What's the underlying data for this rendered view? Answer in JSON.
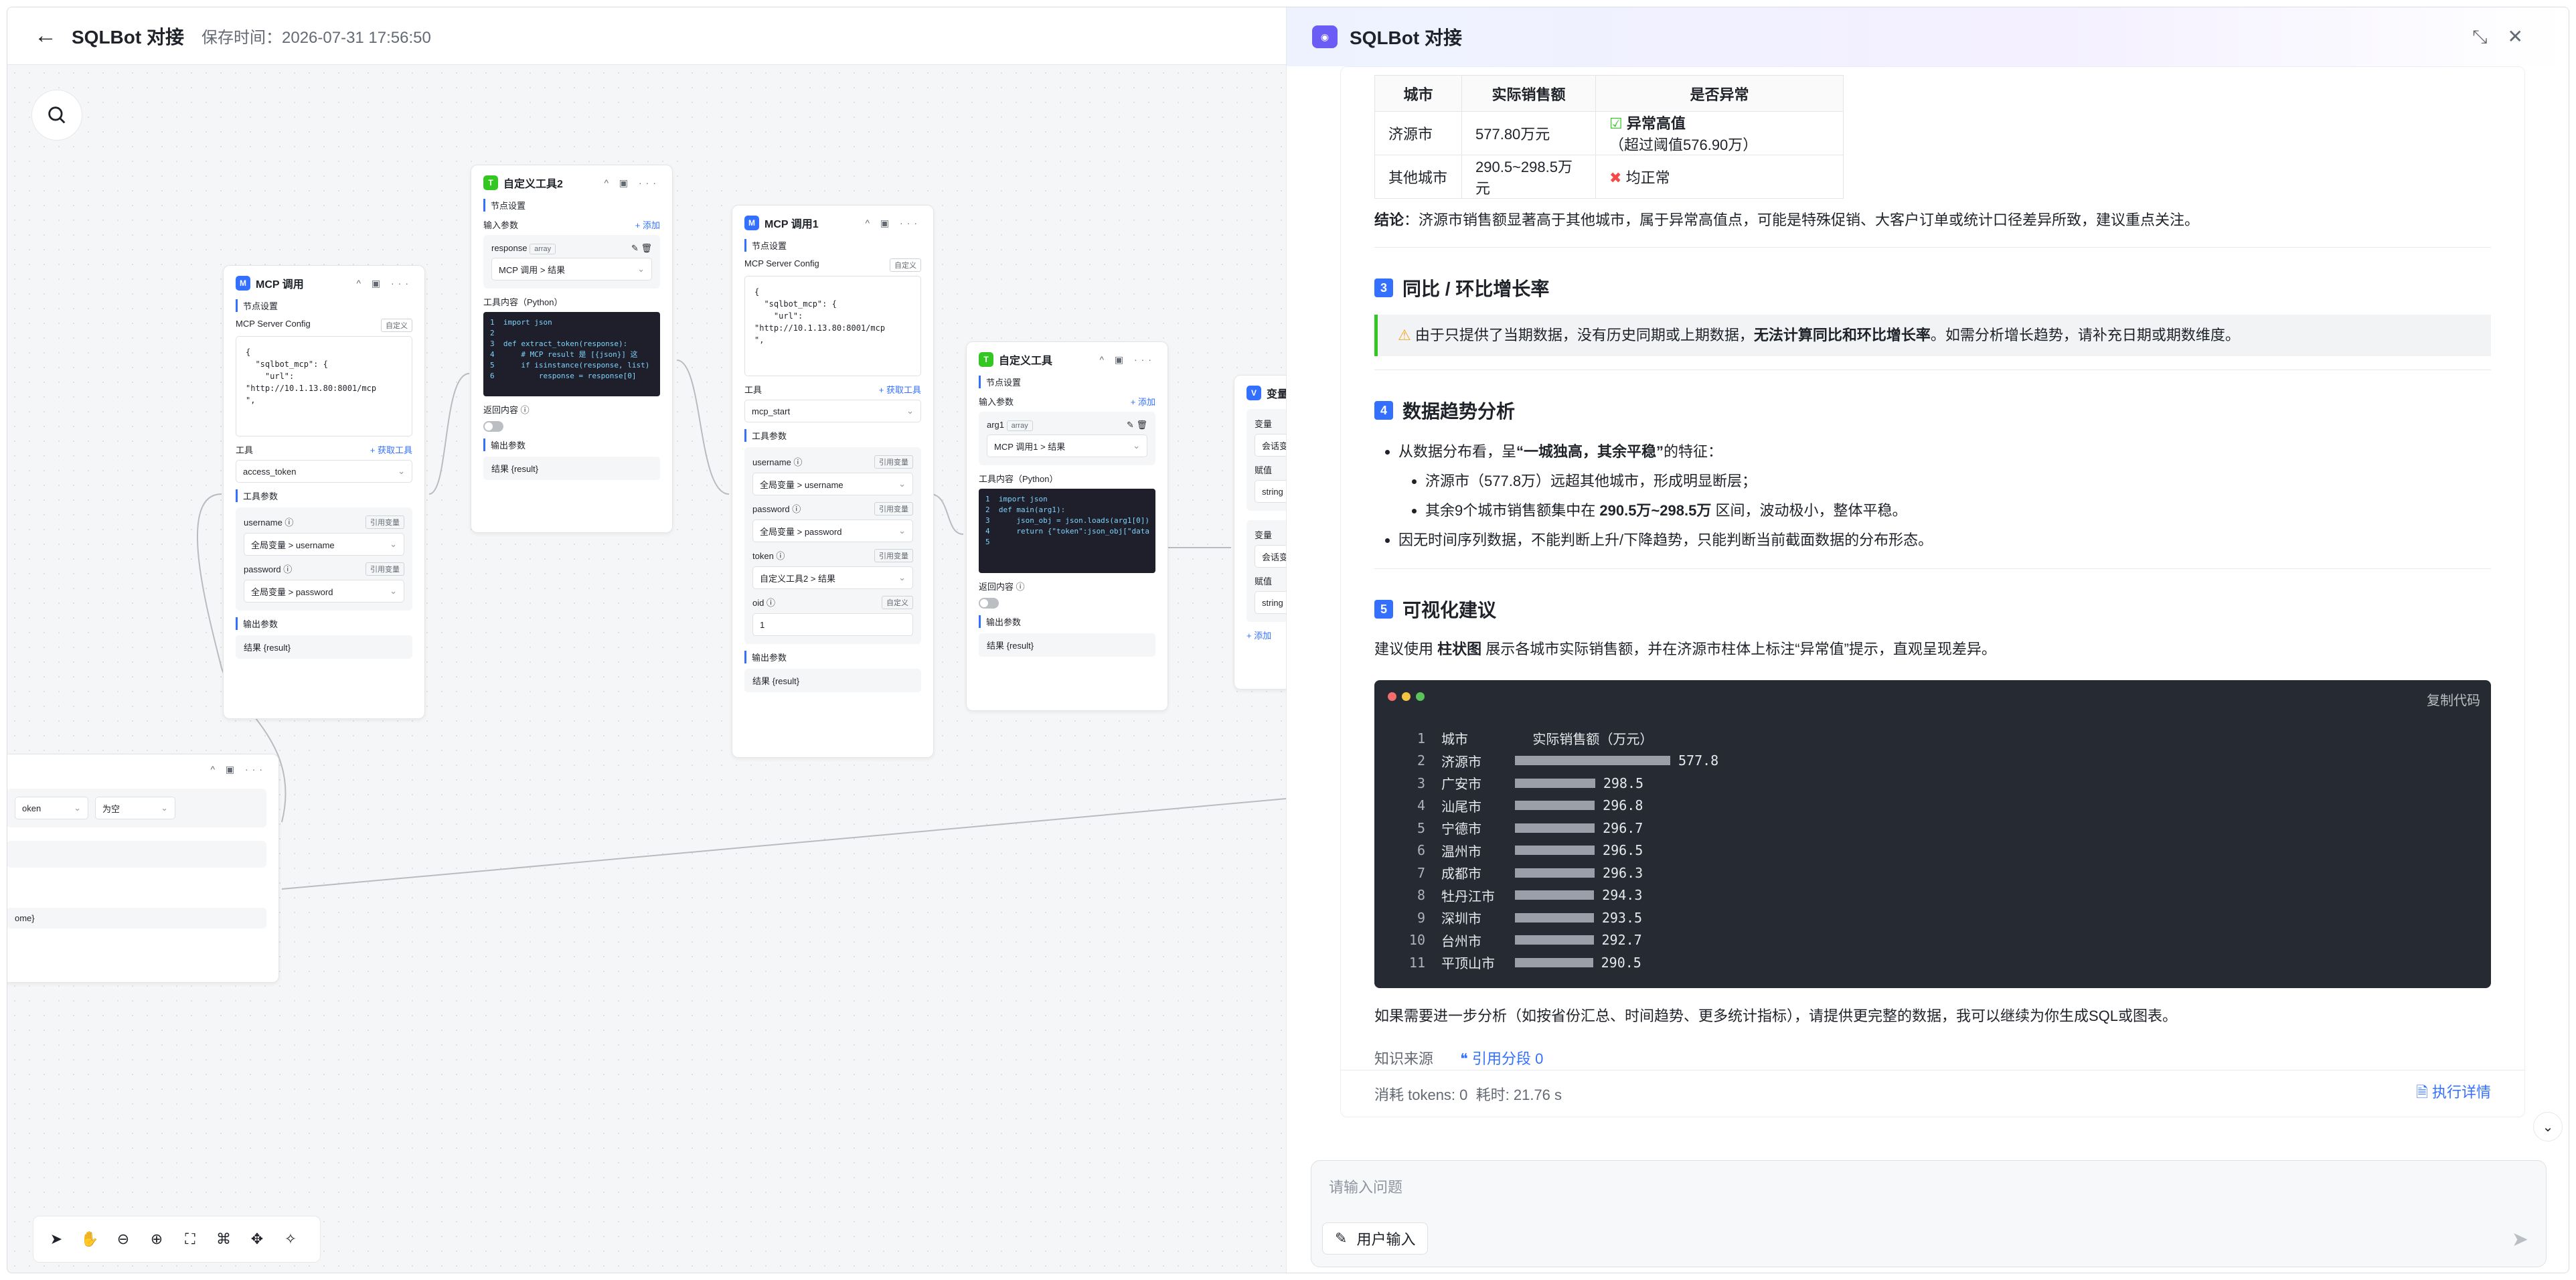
{
  "topbar": {
    "title": "SQLBot 对接",
    "saved": "保存时间：2026-07-31 17:56:50"
  },
  "canvas": {
    "nodes": [
      {
        "title": "MCP 调用",
        "settings": "节点设置",
        "config_label": "MCP Server Config",
        "config_mode": "自定义",
        "config_json": "{\n  \"sqlbot_mcp\": {\n    \"url\":\n\"http://10.1.13.80:8001/mcp\n\",",
        "tool_label": "工具",
        "tool_action": "+ 获取工具",
        "tool_value": "access_token",
        "params_label": "工具参数",
        "p1": "username ⓘ",
        "p1_ref": "引用变量",
        "p1_val": "全局变量 > username",
        "p2": "password ⓘ",
        "p2_ref": "引用变量",
        "p2_val": "全局变量 > password",
        "output_label": "输出参数",
        "output": "结果 {result}"
      },
      {
        "title": "自定义工具2",
        "settings": "节点设置",
        "input_label": "输入参数",
        "add": "+ 添加",
        "param": "response",
        "param_type": "array",
        "param_val": "MCP 调用 > 结果",
        "content_label": "工具内容（Python）",
        "code": "1  import json\n2\n3  def extract_token(response):\n4      # MCP result 是 [{json}] 这\n5      if isinstance(response, list)\n6          response = response[0]",
        "return_label": "返回内容 ⓘ",
        "output_label": "输出参数",
        "output": "结果 {result}"
      },
      {
        "title": "MCP 调用1",
        "settings": "节点设置",
        "config_label": "MCP Server Config",
        "config_mode": "自定义",
        "config_json": "{\n  \"sqlbot_mcp\": {\n    \"url\":\n\"http://10.1.13.80:8001/mcp\n\",",
        "tool_label": "工具",
        "tool_action": "+ 获取工具",
        "tool_value": "mcp_start",
        "params_label": "工具参数",
        "p1": "username ⓘ",
        "p1_ref": "引用变量",
        "p1_val": "全局变量 > username",
        "p2": "password ⓘ",
        "p2_ref": "引用变量",
        "p2_val": "全局变量 > password",
        "p3": "token ⓘ",
        "p3_ref": "引用变量",
        "p3_val": "自定义工具2 > 结果",
        "p4": "oid ⓘ",
        "p4_ref": "自定义",
        "p4_val": "1",
        "output_label": "输出参数",
        "output": "结果 {result}"
      },
      {
        "title": "自定义工具",
        "settings": "节点设置",
        "input_label": "输入参数",
        "add": "+ 添加",
        "param": "arg1",
        "param_type": "array",
        "param_val": "MCP 调用1 > 结果",
        "content_label": "工具内容（Python）",
        "code": "1  import json\n2  def main(arg1):\n3      json_obj = json.loads(arg1[0])\n4      return {\"token\":json_obj[\"data\n5",
        "return_label": "返回内容 ⓘ",
        "output_label": "输出参数",
        "output": "结果 {result}"
      },
      {
        "title": "变量赋",
        "v1": "变量",
        "v1_val": "会话变",
        "v2": "赋值",
        "v2_val": "string",
        "v3": "变量",
        "v3_val": "会话变",
        "v4": "赋值",
        "v4_val": "string",
        "add": "+ 添加"
      },
      {
        "field1": "oken",
        "field2": "为空",
        "output": "ome}"
      }
    ],
    "toolbar": [
      "navigate-icon",
      "hand-icon",
      "zoom-out-icon",
      "zoom-in-icon",
      "fit-icon",
      "layout-icon",
      "move-icon",
      "magic-icon"
    ]
  },
  "panel": {
    "title": "SQLBot 对接",
    "table": {
      "headers": [
        "城市",
        "实际销售额",
        "是否异常"
      ],
      "rows": [
        [
          "济源市",
          "577.80万元",
          "异常高值",
          "（超过阈值576.90万）"
        ],
        [
          "其他城市",
          "290.5~298.5万元",
          "均正常",
          ""
        ]
      ]
    },
    "conclusion_label": "结论",
    "conclusion": "：济源市销售额显著高于其他城市，属于异常高值点，可能是特殊促销、大客户订单或统计口径差异所致，建议重点关注。",
    "s3_num": "3",
    "s3_title": "同比 / 环比增长率",
    "warn_prefix": "由于只提供了当期数据，没有历史同期或上期数据，",
    "warn_bold": "无法计算同比和环比增长率",
    "warn_suffix": "。如需分析增长趋势，请补充日期或期数维度。",
    "s4_num": "4",
    "s4_title": "数据趋势分析",
    "b1_pre": "从数据分布看，呈",
    "b1_bold": "“一城独高，其余平稳”",
    "b1_post": "的特征：",
    "b1_sub1": "济源市（577.8万）远超其他城市，形成明显断层；",
    "b1_sub2_pre": "其余9个城市销售额集中在",
    "b1_sub2_bold": "290.5万~298.5万",
    "b1_sub2_post": "区间，波动极小，整体平稳。",
    "b2": "因无时间序列数据，不能判断上升/下降趋势，只能判断当前截面数据的分布形态。",
    "s5_num": "5",
    "s5_title": "可视化建议",
    "viz_pre": "建议使用",
    "viz_bold": "柱状图",
    "viz_post": "展示各城市实际销售额，并在济源市柱体上标注“异常值”提示，直观呈现差异。",
    "copy": "复制代码",
    "code_header": "城市        实际销售额（万元）",
    "chart_data": {
      "type": "bar",
      "categories": [
        "济源市",
        "广安市",
        "汕尾市",
        "宁德市",
        "温州市",
        "成都市",
        "牡丹江市",
        "深圳市",
        "台州市",
        "平顶山市"
      ],
      "values": [
        577.8,
        298.5,
        296.8,
        296.7,
        296.5,
        296.3,
        294.3,
        293.5,
        292.7,
        290.5
      ]
    },
    "footer_text": "如果需要进一步分析（如按省份汇总、时间趋势、更多统计指标），请提供更完整的数据，我可以继续为你生成SQL或图表。",
    "source_label": "知识来源",
    "source_ref": "引用分段 0",
    "tokens": "消耗 tokens: 0",
    "time": "耗时: 21.76 s",
    "detail": "执行详情",
    "input_placeholder": "请输入问题",
    "user_input": "用户输入"
  }
}
